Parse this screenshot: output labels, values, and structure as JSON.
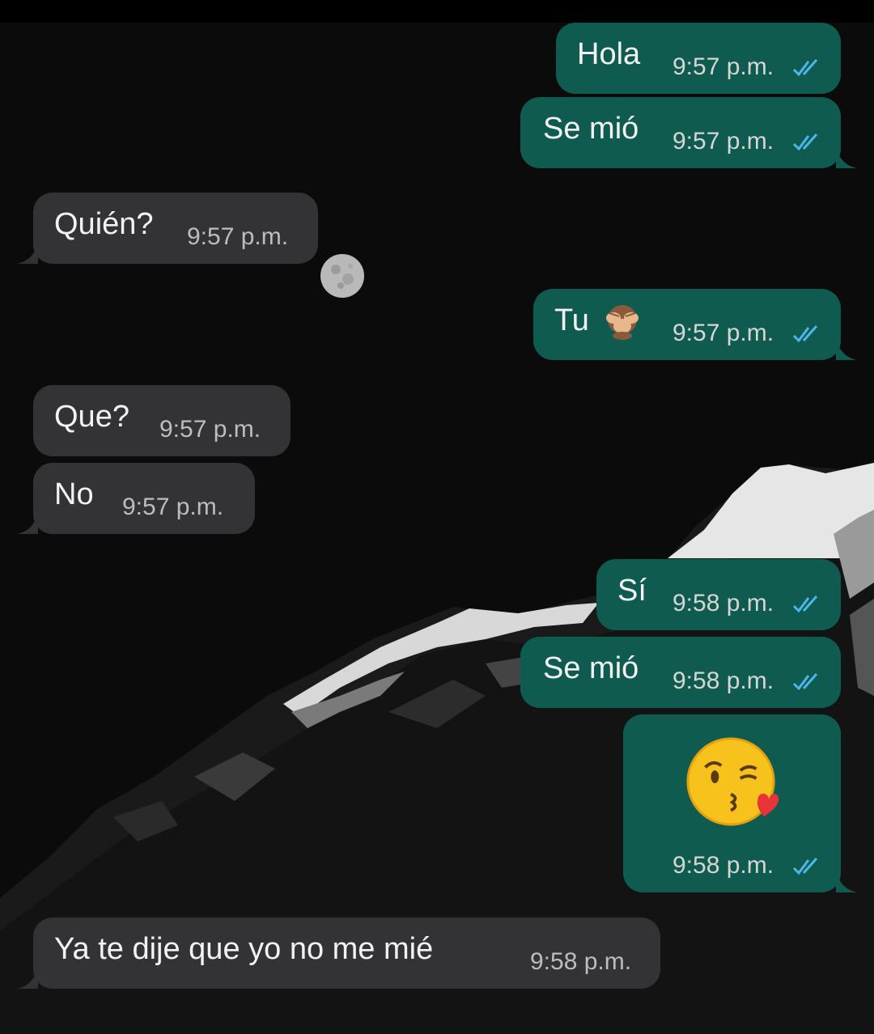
{
  "colors": {
    "outgoing_bubble": "#0f5b4f",
    "incoming_bubble": "#333335",
    "read_ticks": "#4fb6ec",
    "background": "#0b0b0b"
  },
  "messages": [
    {
      "direction": "out",
      "text": "Hola",
      "time": "9:57 p.m.",
      "status": "read"
    },
    {
      "direction": "out",
      "text": "Se mió",
      "time": "9:57 p.m.",
      "status": "read"
    },
    {
      "direction": "in",
      "text": "Quién?",
      "time": "9:57 p.m."
    },
    {
      "direction": "out",
      "text": "Tu",
      "emoji": "see-no-evil-monkey-icon",
      "time": "9:57 p.m.",
      "status": "read"
    },
    {
      "direction": "in",
      "text": "Que?",
      "time": "9:57 p.m."
    },
    {
      "direction": "in",
      "text": "No",
      "time": "9:57 p.m."
    },
    {
      "direction": "out",
      "text": "Sí",
      "time": "9:58 p.m.",
      "status": "read"
    },
    {
      "direction": "out",
      "text": "Se mió",
      "time": "9:58 p.m.",
      "status": "read"
    },
    {
      "direction": "out",
      "emoji": "face-blowing-kiss-icon",
      "time": "9:58 p.m.",
      "status": "read"
    },
    {
      "direction": "in",
      "text": "Ya te dije que yo no me mié",
      "time": "9:58 p.m."
    }
  ]
}
